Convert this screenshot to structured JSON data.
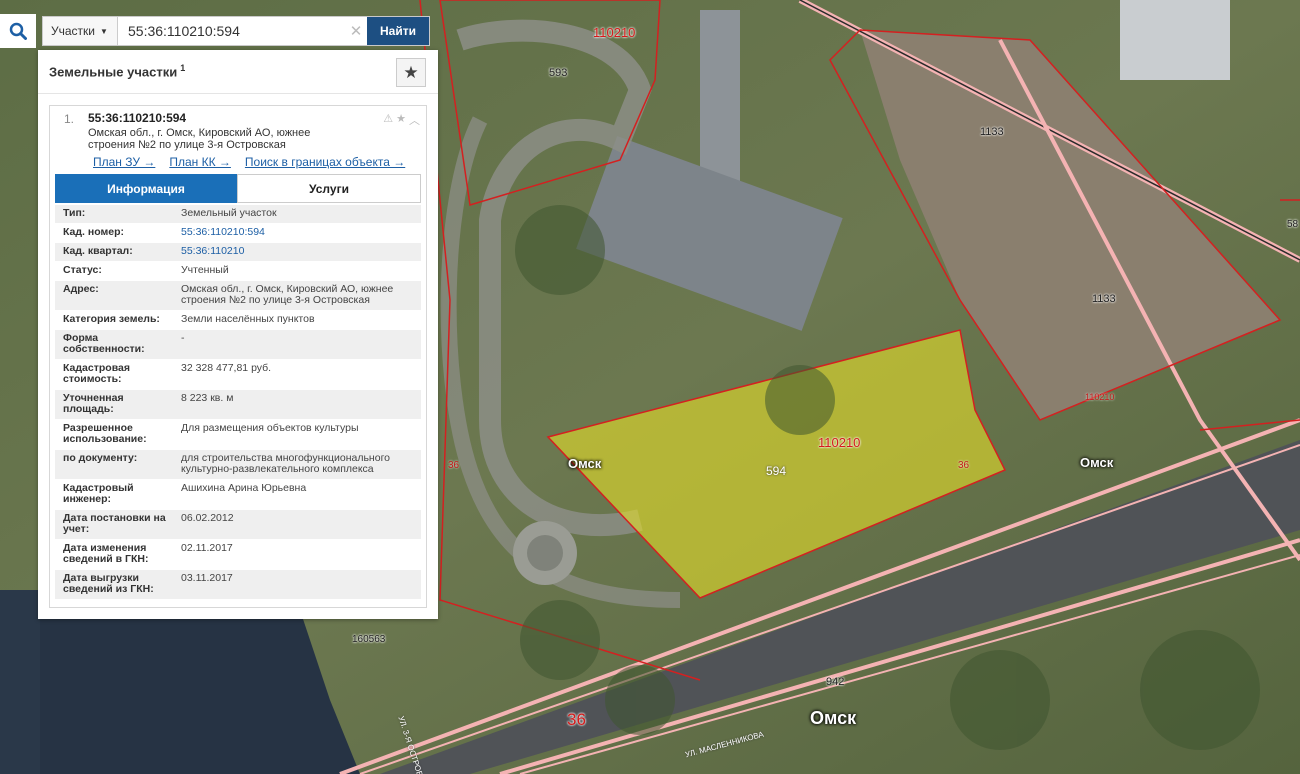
{
  "search": {
    "type_label": "Участки",
    "query": "55:36:110210:594",
    "find_label": "Найти"
  },
  "panel": {
    "title": "Земельные участки",
    "count": "1"
  },
  "card": {
    "index": "1.",
    "cad_number": "55:36:110210:594",
    "address": "Омская обл., г. Омск, Кировский АО, южнее строения №2 по улице 3-я Островская",
    "links": [
      "План ЗУ →",
      "План КК →",
      "Поиск в границах объекта →"
    ],
    "tabs": [
      "Информация",
      "Услуги"
    ]
  },
  "attributes": [
    {
      "k": "Тип:",
      "v": "Земельный участок"
    },
    {
      "k": "Кад. номер:",
      "v": "55:36:110210:594",
      "link": true
    },
    {
      "k": "Кад. квартал:",
      "v": "55:36:110210",
      "link": true
    },
    {
      "k": "Статус:",
      "v": "Учтенный"
    },
    {
      "k": "Адрес:",
      "v": "Омская обл., г. Омск, Кировский АО, южнее строения №2 по улице 3-я Островская"
    },
    {
      "k": "Категория земель:",
      "v": "Земли населённых пунктов"
    },
    {
      "k": "Форма собственности:",
      "v": "-"
    },
    {
      "k": "Кадастровая стоимость:",
      "v": "32 328 477,81 руб."
    },
    {
      "k": "Уточненная площадь:",
      "v": "8 223 кв. м"
    },
    {
      "k": "Разрешенное использование:",
      "v": "Для размещения объектов культуры"
    },
    {
      "k": "по документу:",
      "v": "для строительства многофункционального культурно-развлекательного комплекса"
    },
    {
      "k": "Кадастровый инженер:",
      "v": "Ашихина Арина Юрьевна"
    },
    {
      "k": "Дата постановки на учет:",
      "v": "06.02.2012"
    },
    {
      "k": "Дата изменения сведений в ГКН:",
      "v": "02.11.2017"
    },
    {
      "k": "Дата выгрузки сведений из ГКН:",
      "v": "03.11.2017"
    }
  ],
  "map": {
    "labels": {
      "quarter_top": "110210",
      "parcel_593": "593",
      "parcel_1133_a": "1133",
      "parcel_1133_b": "1133",
      "parcel_594": "594",
      "quarter_center": "110210",
      "omsk_left": "Омск",
      "omsk_right": "Омск",
      "omsk_bottom": "Омск",
      "n36_left": "36",
      "n36_right": "36",
      "n36_bottom": "36",
      "n942": "942",
      "n160563": "160563",
      "street_left": "УЛ. 3-Я ОСТРОВСКАЯ",
      "street_bottom": "УЛ. МАСЛЕННИКОВА",
      "edge_58": "58",
      "small_110210": "110210"
    },
    "colors": {
      "boundary": "#d42020",
      "highlight_fill": "#e6e02a",
      "road_line": "#f4b3b3"
    }
  }
}
